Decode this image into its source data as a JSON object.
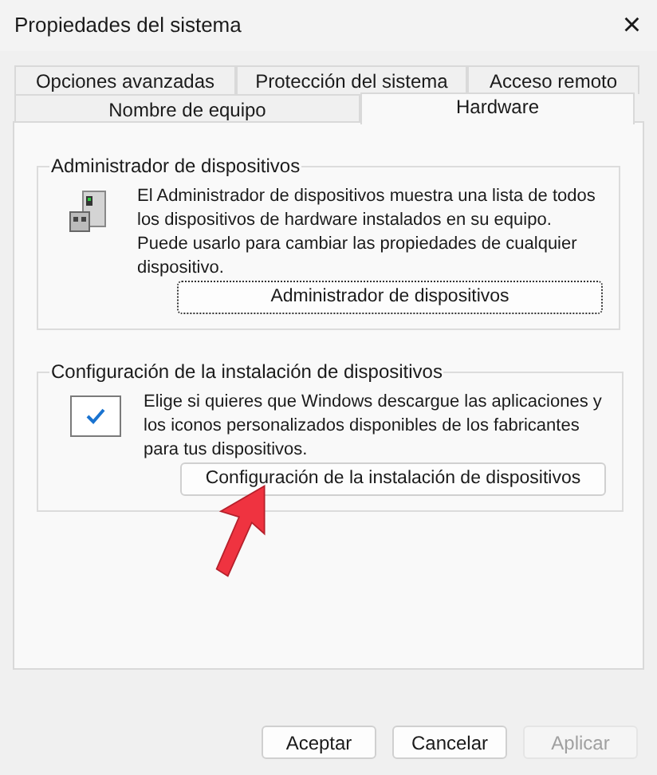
{
  "window": {
    "title": "Propiedades del sistema",
    "close": "×"
  },
  "tabs": [
    [
      {
        "label": "Opciones avanzadas",
        "selected": false
      },
      {
        "label": "Protección del sistema",
        "selected": false
      },
      {
        "label": "Acceso remoto",
        "selected": false
      }
    ],
    [
      {
        "label": "Nombre de equipo",
        "selected": false
      },
      {
        "label": "Hardware",
        "selected": true
      }
    ]
  ],
  "groups": [
    {
      "kind": "device-manager",
      "title": "Administrador de dispositivos",
      "text": "El Administrador de dispositivos muestra una lista de todos los dispositivos de hardware instalados en su equipo. Puede usarlo para cambiar las propiedades de cualquier dispositivo.",
      "button": "Administrador de dispositivos",
      "focused": true
    },
    {
      "kind": "install-settings",
      "title": "Configuración de la instalación de dispositivos",
      "text": "Elige si quieres que Windows descargue las aplicaciones y los iconos personalizados disponibles de los fabricantes para tus dispositivos.",
      "button": "Configuración de la instalación de dispositivos",
      "focused": false
    }
  ],
  "buttons": [
    {
      "label": "Aceptar",
      "disabled": false
    },
    {
      "label": "Cancelar",
      "disabled": false
    },
    {
      "label": "Aplicar",
      "disabled": true
    }
  ]
}
